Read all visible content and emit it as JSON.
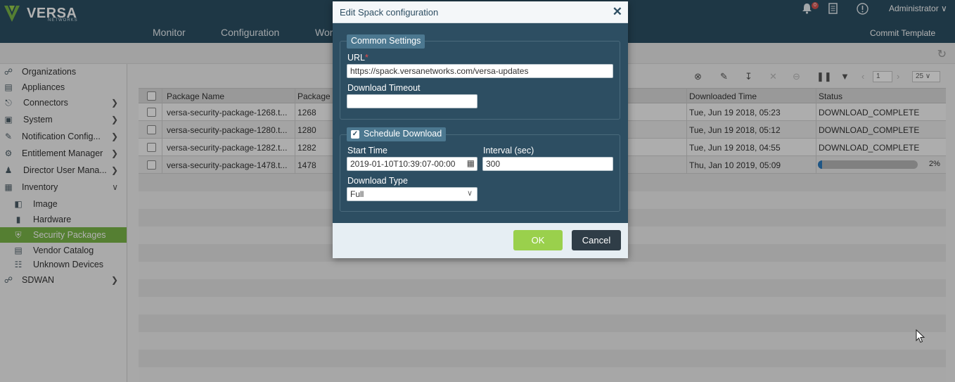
{
  "app": {
    "logo_text": "VERSA",
    "logo_sub": "NETWORKS",
    "nav": [
      "Monitor",
      "Configuration",
      "Wor"
    ],
    "notifications_count": "0",
    "user": "Administrator",
    "commit_label": "Commit Template"
  },
  "sidebar": {
    "items": [
      {
        "label": "Organizations",
        "icon": "organizations-icon"
      },
      {
        "label": "Appliances",
        "icon": "appliances-icon"
      },
      {
        "label": "Connectors",
        "icon": "connectors-icon"
      },
      {
        "label": "System",
        "icon": "system-icon"
      },
      {
        "label": "Notification Config...",
        "icon": "notification-icon"
      },
      {
        "label": "Entitlement Manager",
        "icon": "gear-icon"
      },
      {
        "label": "Director User Mana...",
        "icon": "users-icon"
      },
      {
        "label": "Inventory",
        "icon": "inventory-icon"
      },
      {
        "label": "Image",
        "icon": "image-icon"
      },
      {
        "label": "Hardware",
        "icon": "hardware-icon"
      },
      {
        "label": "Security Packages",
        "icon": "shield-icon"
      },
      {
        "label": "Vendor Catalog",
        "icon": "catalog-icon"
      },
      {
        "label": "Unknown Devices",
        "icon": "devices-icon"
      },
      {
        "label": "SDWAN",
        "icon": "sdwan-icon"
      }
    ]
  },
  "pager": {
    "page": "1",
    "page_size": "25"
  },
  "table": {
    "columns": [
      "Package Name",
      "Package",
      "Downloaded Time",
      "Status"
    ],
    "rows": [
      {
        "name": "versa-security-package-1268.t...",
        "version": "1268",
        "time": "Tue, Jun 19 2018, 05:23",
        "status": "DOWNLOAD_COMPLETE"
      },
      {
        "name": "versa-security-package-1280.t...",
        "version": "1280",
        "time": "Tue, Jun 19 2018, 05:12",
        "status": "DOWNLOAD_COMPLETE"
      },
      {
        "name": "versa-security-package-1282.t...",
        "version": "1282",
        "time": "Tue, Jun 19 2018, 04:55",
        "status": "DOWNLOAD_COMPLETE"
      },
      {
        "name": "versa-security-package-1478.t...",
        "version": "1478",
        "time": "Thu, Jan 10 2019, 05:09",
        "status": "",
        "progress": 0.02,
        "progress_label": "2%"
      }
    ]
  },
  "modal": {
    "title": "Edit Spack configuration",
    "common_settings": "Common Settings",
    "url_label": "URL",
    "url_required": "*",
    "url_value": "https://spack.versanetworks.com/versa-updates",
    "timeout_label": "Download Timeout",
    "timeout_value": "",
    "schedule_label": "Schedule Download",
    "schedule_checked": true,
    "start_time_label": "Start Time",
    "start_time_value": "2019-01-10T10:39:07-00:00",
    "interval_label": "Interval (sec)",
    "interval_value": "300",
    "download_type_label": "Download Type",
    "download_type_value": "Full",
    "ok_label": "OK",
    "cancel_label": "Cancel"
  },
  "colors": {
    "header": "#2b4f64",
    "active_item": "#7ab648",
    "ok_button": "#9ad04c",
    "cancel_button": "#2f3d47",
    "progress": "#2d7bbf"
  }
}
